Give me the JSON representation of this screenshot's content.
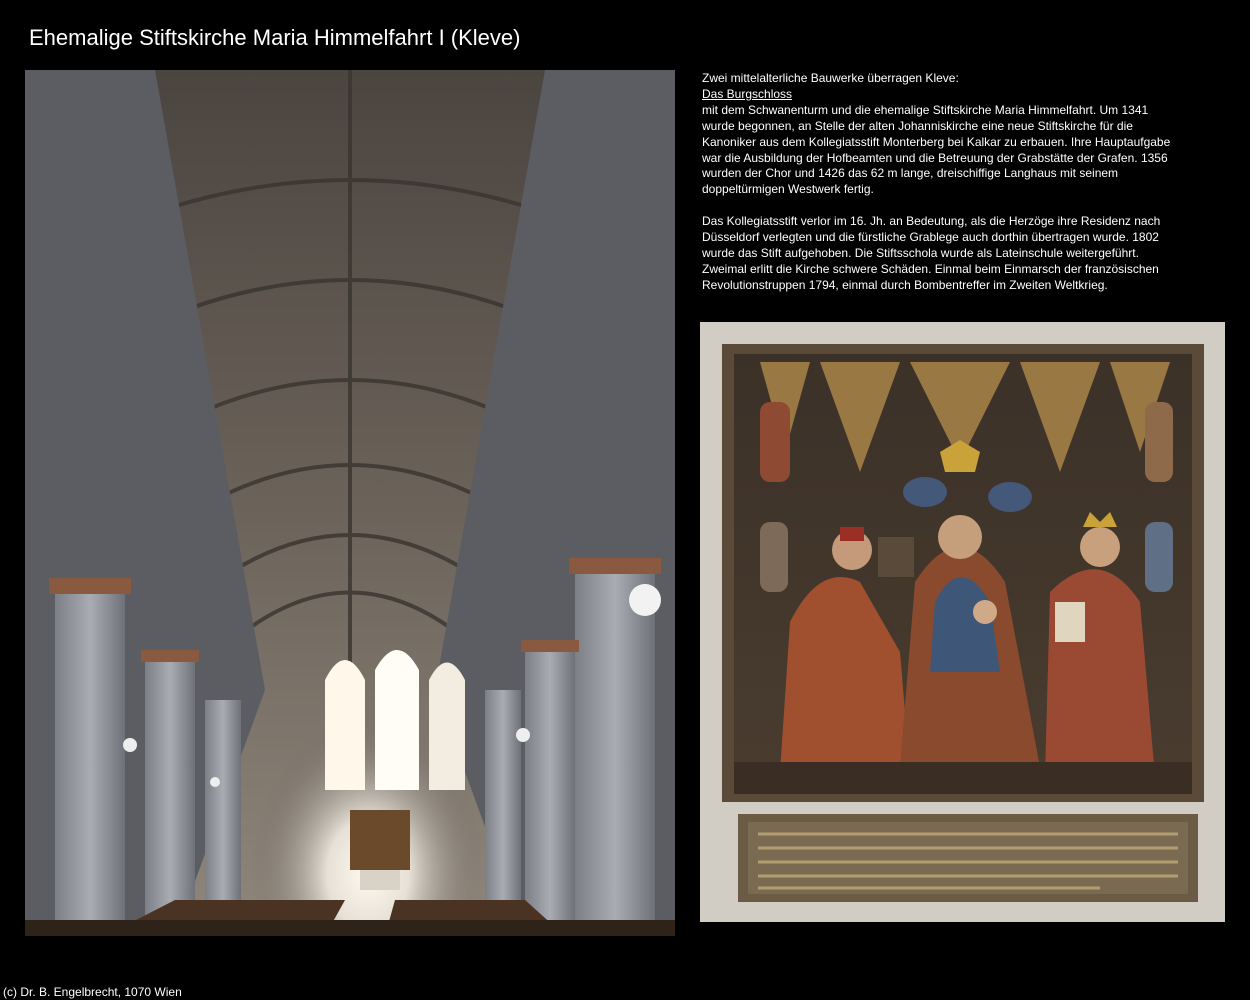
{
  "page": {
    "title": "Ehemalige Stiftskirche Maria Himmelfahrt I (Kleve)",
    "copyright": "(c) Dr. B. Engelbrecht, 1070 Wien"
  },
  "description": {
    "intro": "Zwei mittelalterliche Bauwerke überragen Kleve:",
    "link_label": "Das Burgschloss",
    "para1_rest": "mit dem Schwanenturm und die ehemalige Stiftskirche Maria Himmelfahrt. Um 1341 wurde begonnen, an Stelle der alten Johanniskirche eine neue Stiftskirche für die Kanoniker aus dem Kollegiatsstift Monterberg bei Kalkar zu erbauen. Ihre Hauptaufgabe war die Ausbildung der Hofbeamten und die Betreuung der Grabstätte der Grafen. 1356 wurden der Chor und 1426 das 62 m lange, dreischiffige Langhaus mit seinem doppeltürmigen Westwerk fertig.",
    "para2": "Das Kollegiatsstift verlor im 16. Jh. an Bedeutung, als die Herzöge ihre Residenz nach Düsseldorf verlegten und die fürstliche Grablege auch dorthin übertragen wurde. 1802 wurde das Stift aufgehoben. Die Stiftsschola wurde als Lateinschule weitergeführt. Zweimal erlitt die Kirche schwere Schäden. Einmal beim Einmarsch der französischen Revolutionstruppen 1794, einmal durch Bombentreffer im Zweiten Weltkrieg."
  },
  "photos": {
    "left": {
      "icon": "church-interior-photo"
    },
    "right": {
      "icon": "carved-relief-photo"
    }
  },
  "colors": {
    "background": "#000000",
    "text": "#ffffff"
  }
}
